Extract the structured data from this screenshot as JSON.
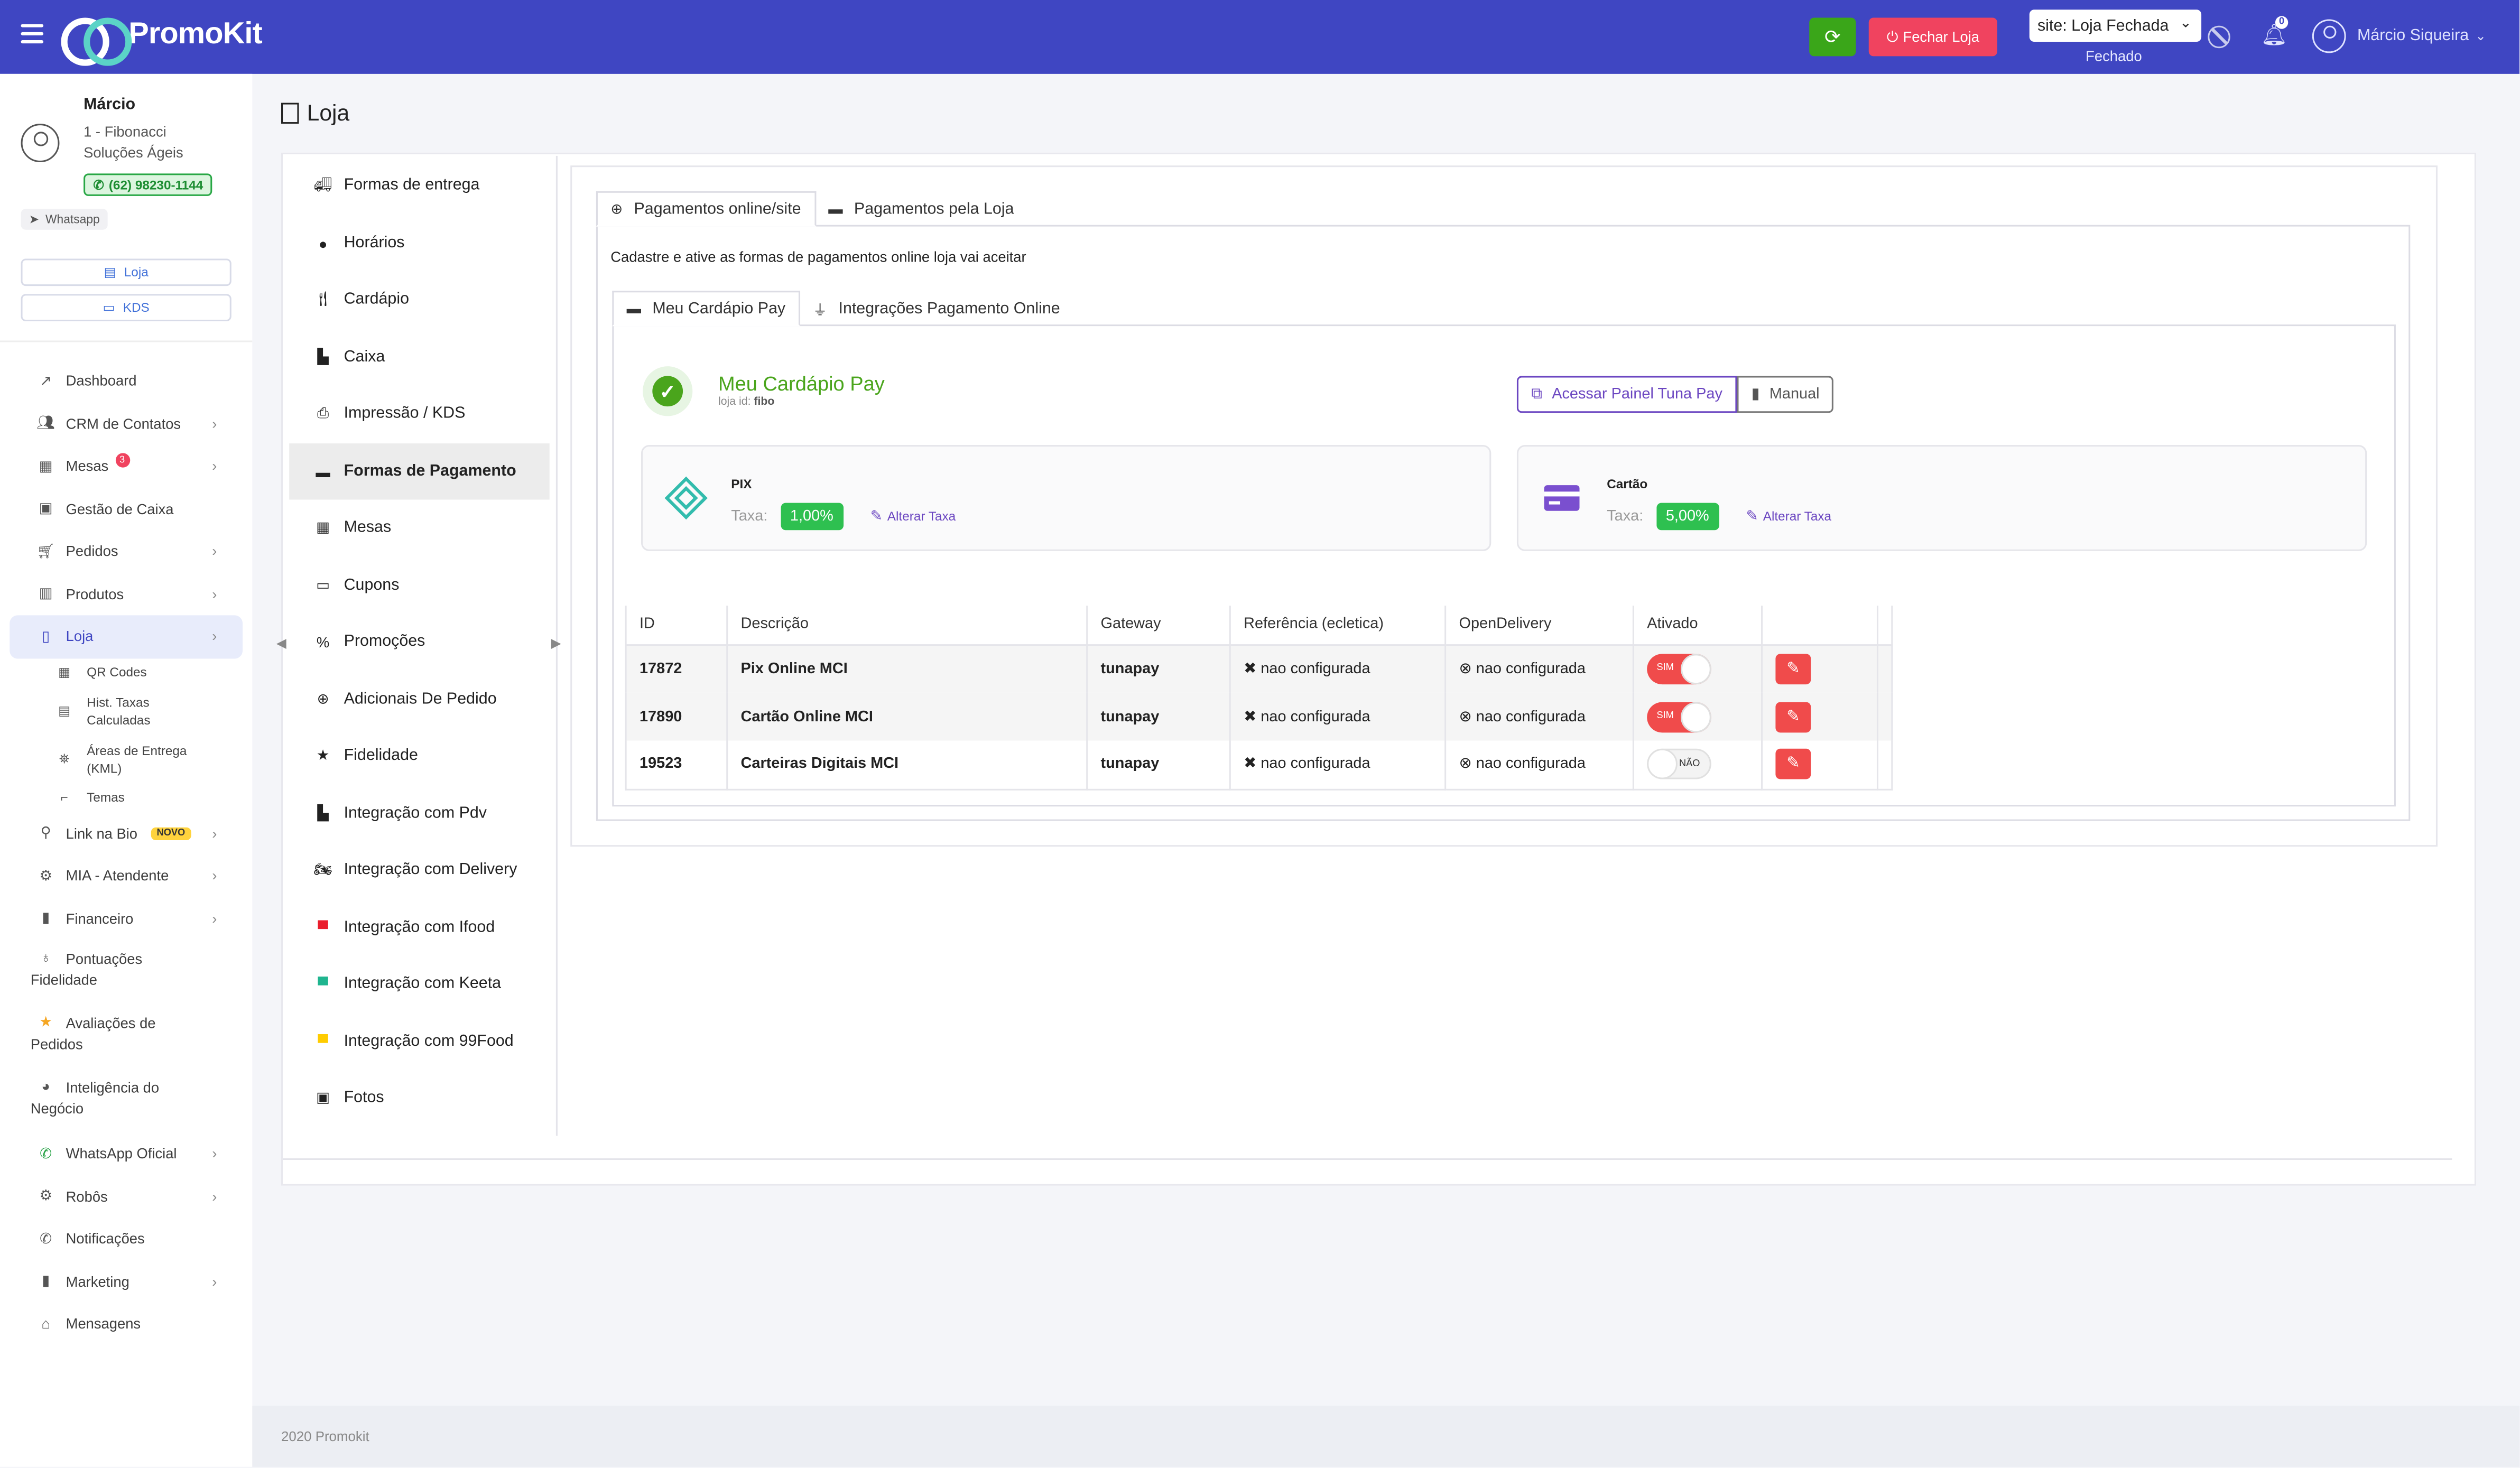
{
  "app": {
    "name": "PromoKit"
  },
  "topbar": {
    "close_label": "Fechar Loja",
    "site_select": "site: Loja Fechada",
    "site_status": "Fechado",
    "notifications": "0",
    "user_name": "Márcio Siqueira"
  },
  "profile": {
    "name": "Márcio",
    "company": "1 - Fibonacci Soluções Ágeis",
    "phone": "(62) 98230-1144",
    "whatsapp": "Whatsapp",
    "btn_loja": "Loja",
    "btn_kds": "KDS"
  },
  "menu": {
    "dashboard": "Dashboard",
    "crm": "CRM de Contatos",
    "mesas": "Mesas",
    "mesas_badge": "3",
    "gestao": "Gestão de Caixa",
    "pedidos": "Pedidos",
    "produtos": "Produtos",
    "loja": "Loja",
    "qr": "QR Codes",
    "hist": "Hist. Taxas Calculadas",
    "areas": "Áreas de Entrega (KML)",
    "temas": "Temas",
    "linkbio": "Link na Bio",
    "novo": "NOVO",
    "mia": "MIA - Atendente",
    "financeiro": "Financeiro",
    "pontuacoes": "Pontuações Fidelidade",
    "avaliacoes": "Avaliações de Pedidos",
    "inteligencia": "Inteligência do Negócio",
    "whatsapp": "WhatsApp Oficial",
    "robos": "Robôs",
    "notificacoes": "Notificações",
    "marketing": "Marketing",
    "mensagens": "Mensagens"
  },
  "page": {
    "title": "Loja"
  },
  "store_menu": [
    "Formas de entrega",
    "Horários",
    "Cardápio",
    "Caixa",
    "Impressão / KDS",
    "Formas de Pagamento",
    "Mesas",
    "Cupons",
    "Promoções",
    "Adicionais De Pedido",
    "Fidelidade",
    "Integração com Pdv",
    "Integração com Delivery",
    "Integração com Ifood",
    "Integração com Keeta",
    "Integração com 99Food",
    "Fotos"
  ],
  "tabs": {
    "online": "Pagamentos online/site",
    "loja": "Pagamentos pela Loja"
  },
  "intro": "Cadastre e ative as formas de pagamentos online loja vai aceitar",
  "subtabs": {
    "mcp": "Meu Cardápio Pay",
    "integ": "Integrações Pagamento Online"
  },
  "mcp": {
    "title": "Meu Cardápio Pay",
    "loja_id_label": "loja id:",
    "loja_id": "fibo",
    "btn_painel": "Acessar Painel Tuna Pay",
    "btn_manual": "Manual"
  },
  "methods": {
    "pix": {
      "name": "PIX",
      "fee_label": "Taxa:",
      "fee": "1,00%",
      "alter": "Alterar Taxa"
    },
    "card": {
      "name": "Cartão",
      "fee_label": "Taxa:",
      "fee": "5,00%",
      "alter": "Alterar Taxa"
    }
  },
  "table": {
    "headers": [
      "ID",
      "Descrição",
      "Gateway",
      "Referência (ecletica)",
      "OpenDelivery",
      "Ativado",
      ""
    ],
    "rows": [
      {
        "id": "17872",
        "desc": "Pix Online MCI",
        "gateway": "tunapay",
        "ref": "nao configurada",
        "od": "nao configurada",
        "toggle": "SIM"
      },
      {
        "id": "17890",
        "desc": "Cartão Online MCI",
        "gateway": "tunapay",
        "ref": "nao configurada",
        "od": "nao configurada",
        "toggle": "SIM"
      },
      {
        "id": "19523",
        "desc": "Carteiras Digitais MCI",
        "gateway": "tunapay",
        "ref": "nao configurada",
        "od": "nao configurada",
        "toggle": "NÃO"
      }
    ]
  },
  "footer": "2020 Promokit",
  "colors": {
    "primary": "#3f46c2",
    "green": "#3aa619",
    "red": "#f0435f",
    "purple": "#6b46c1"
  }
}
